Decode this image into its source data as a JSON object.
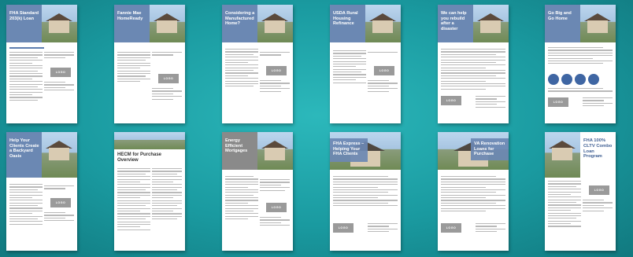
{
  "flyers_top": [
    {
      "title": "FHA Standard 203(k) Loan"
    },
    {
      "title": "Fannie Mae HomeReady"
    },
    {
      "title": "Considering a Manufactured Home?"
    },
    {
      "title": "USDA Rural Housing Refinance"
    },
    {
      "title": "We can help you rebuild after a disaster"
    },
    {
      "title": "Go Big and Go Home"
    }
  ],
  "flyers_bottom": [
    {
      "title": "Help Your Clients Create a Backyard Oasis"
    },
    {
      "title": "HECM for Purchase Overview"
    },
    {
      "title": "Energy Efficient Mortgages"
    },
    {
      "title": "FHA Express – Helping Your FHA Clients"
    },
    {
      "title": "VA Renovation Loans for Purchase"
    },
    {
      "title": "FHA 100% CLTV Combo Loan Program"
    }
  ],
  "logo_label": "LOGO",
  "colors": {
    "background": "#1a9aa0",
    "header_blue": "#6b88b3"
  }
}
